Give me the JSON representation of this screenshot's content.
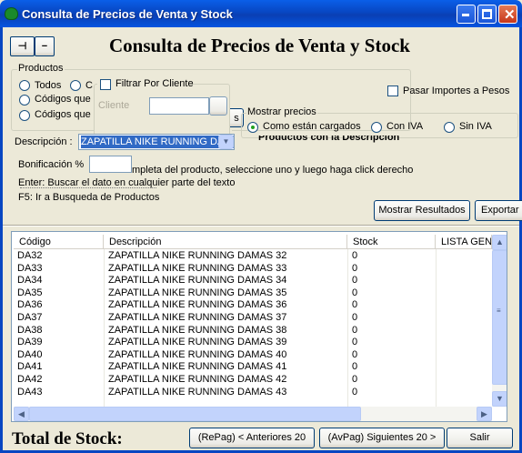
{
  "window": {
    "title": "Consulta de Precios de Venta y Stock"
  },
  "toolbar": {
    "pin_label": "⊣",
    "minus_label": "−"
  },
  "heading": "Consulta de Precios de Venta y Stock",
  "productos": {
    "legend": "Productos",
    "opt_todos": "Todos",
    "opt_c": "C",
    "opt_codigos1": "Códigos que",
    "opt_codigos2": "Códigos que"
  },
  "filtro": {
    "label": "Filtrar Por Cliente",
    "cliente_label": "Cliente",
    "cliente_value": "",
    "browse_label": ""
  },
  "pasar_importes": "Pasar Importes a Pesos",
  "mostrar_precios": {
    "legend": "Mostrar precios",
    "opt_cargados": "Como están cargados",
    "opt_con_iva": "Con IVA",
    "opt_sin_iva": "Sin IVA"
  },
  "partial_button": "s",
  "descripcion": {
    "label": "Descripción :",
    "value": "ZAPATILLA NIKE RUNNING DAMAS",
    "hidden_label": "Productos con la Descripción"
  },
  "bonificacion": {
    "label": "Bonificación %",
    "value": ""
  },
  "help": {
    "line1": "mpleta del producto, seleccione uno y luego haga click derecho",
    "line2": "Enter: Buscar el dato en cualquier parte del texto",
    "line3": "F5: Ir a Busqueda de Productos"
  },
  "buttons": {
    "mostrar": "Mostrar Resultados",
    "exportar": "Exportar"
  },
  "table": {
    "columns": [
      "Código",
      "Descripción",
      "Stock",
      "LISTA GEN"
    ],
    "rows": [
      [
        "DA32",
        "ZAPATILLA NIKE RUNNING DAMAS 32",
        "0",
        ""
      ],
      [
        "DA33",
        "ZAPATILLA NIKE RUNNING DAMAS 33",
        "0",
        ""
      ],
      [
        "DA34",
        "ZAPATILLA NIKE RUNNING DAMAS 34",
        "0",
        ""
      ],
      [
        "DA35",
        "ZAPATILLA NIKE RUNNING DAMAS 35",
        "0",
        ""
      ],
      [
        "DA36",
        "ZAPATILLA NIKE RUNNING DAMAS 36",
        "0",
        ""
      ],
      [
        "DA37",
        "ZAPATILLA NIKE RUNNING DAMAS 37",
        "0",
        ""
      ],
      [
        "DA38",
        "ZAPATILLA NIKE RUNNING DAMAS 38",
        "0",
        ""
      ],
      [
        "DA39",
        "ZAPATILLA NIKE RUNNING DAMAS 39",
        "0",
        ""
      ],
      [
        "DA40",
        "ZAPATILLA NIKE RUNNING DAMAS 40",
        "0",
        ""
      ],
      [
        "DA41",
        "ZAPATILLA NIKE RUNNING DAMAS 41",
        "0",
        ""
      ],
      [
        "DA42",
        "ZAPATILLA NIKE RUNNING DAMAS 42",
        "0",
        ""
      ],
      [
        "DA43",
        "ZAPATILLA NIKE RUNNING DAMAS 43",
        "0",
        ""
      ]
    ]
  },
  "footer": {
    "total_label": "Total de Stock:",
    "prev": "(RePag) < Anteriores 20",
    "next": "(AvPag) Siguientes 20 >",
    "salir": "Salir"
  }
}
